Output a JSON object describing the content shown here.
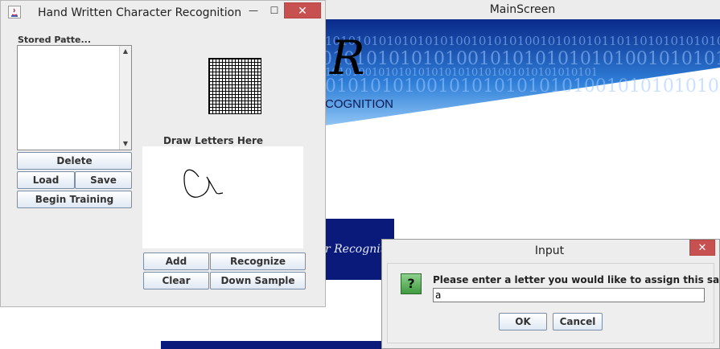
{
  "main_screen": {
    "title": "MainScreen",
    "banner_partial_letter": "R",
    "banner_partial_word": "COGNITION",
    "banner_binary_rows": [
      "1010101010101010100101010100101010101101101010101010",
      "010101010101001010101010101001010101010101",
      "10101001010101010101010101001010101010101",
      "01010101001010101010101001010101010110"
    ],
    "banner_mid_text": "r Recognition",
    "colors": {
      "banner_blue": "#0a1a7a",
      "banner_light": "#1e63c8"
    }
  },
  "hwcr": {
    "title": "Hand Written Character Recognition",
    "stored_label": "Stored Patte...",
    "buttons": {
      "delete": "Delete",
      "load": "Load",
      "save": "Save",
      "begin_training": "Begin Training",
      "add": "Add",
      "recognize": "Recognize",
      "clear": "Clear",
      "down_sample": "Down Sample"
    },
    "draw_label": "Draw Letters Here",
    "window_buttons": {
      "minimize": "—",
      "maximize": "☐",
      "close": "✕"
    }
  },
  "input_dialog": {
    "title": "Input",
    "close": "✕",
    "prompt": "Please enter a letter you would like to assign this sample to.",
    "value": "a",
    "ok": "OK",
    "cancel": "Cancel",
    "icon_glyph": "?"
  }
}
